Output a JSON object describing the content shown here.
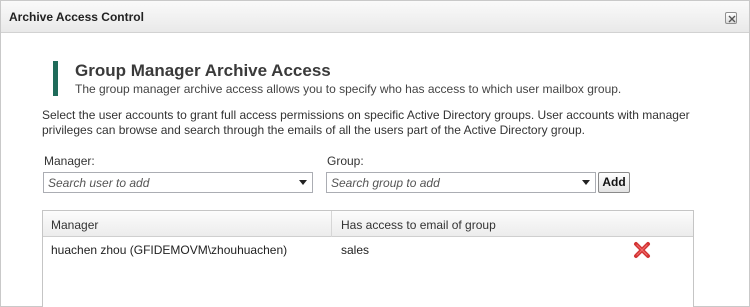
{
  "window": {
    "title": "Archive Access Control",
    "accent_color": "#1f6b5a",
    "delete_color": "#d23434"
  },
  "section": {
    "heading": "Group Manager Archive Access",
    "subheading": "The group manager archive access allows you to specify who has access to which user mailbox group.",
    "description": "Select the user accounts to grant full access permissions on specific Active Directory groups. User accounts with manager privileges can browse and search through the emails of all the users part of the Active Directory group."
  },
  "form": {
    "manager_label": "Manager:",
    "manager_placeholder": "Search user to add",
    "group_label": "Group:",
    "group_placeholder": "Search group to add",
    "add_label": "Add"
  },
  "grid": {
    "columns": [
      "Manager",
      "Has access to email of group"
    ],
    "rows": [
      {
        "manager": "huachen zhou (GFIDEMOVM\\zhouhuachen)",
        "group": "sales",
        "action_icon": "delete-x-icon"
      }
    ]
  }
}
